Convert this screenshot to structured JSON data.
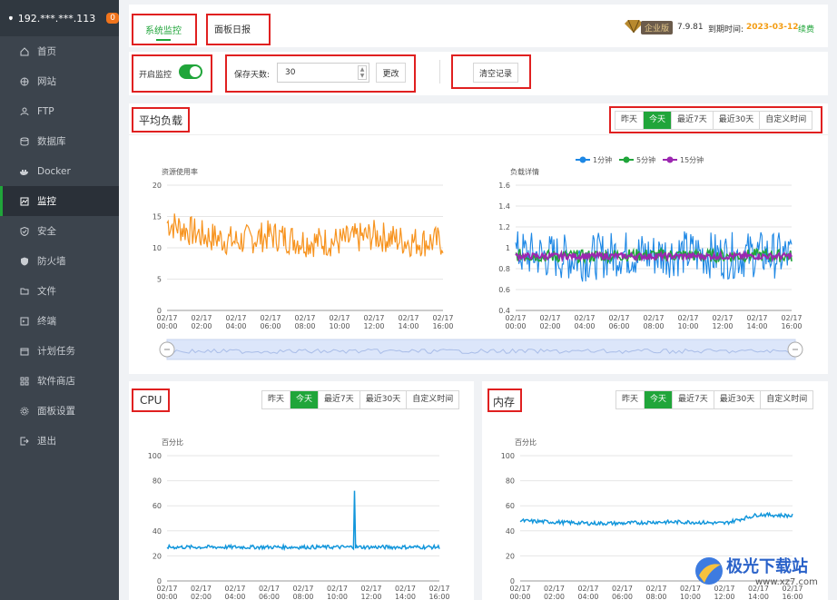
{
  "sidebar": {
    "ip": "192.***.***.113",
    "badge": "0",
    "items": [
      {
        "label": "首页",
        "icon": "home-icon"
      },
      {
        "label": "网站",
        "icon": "globe-icon"
      },
      {
        "label": "FTP",
        "icon": "ftp-icon"
      },
      {
        "label": "数据库",
        "icon": "database-icon"
      },
      {
        "label": "Docker",
        "icon": "docker-icon"
      },
      {
        "label": "监控",
        "icon": "monitor-icon",
        "active": true
      },
      {
        "label": "安全",
        "icon": "shield-check-icon"
      },
      {
        "label": "防火墙",
        "icon": "firewall-icon"
      },
      {
        "label": "文件",
        "icon": "folder-icon"
      },
      {
        "label": "终端",
        "icon": "terminal-icon"
      },
      {
        "label": "计划任务",
        "icon": "calendar-icon"
      },
      {
        "label": "软件商店",
        "icon": "apps-icon"
      },
      {
        "label": "面板设置",
        "icon": "gear-icon"
      },
      {
        "label": "退出",
        "icon": "logout-icon"
      }
    ]
  },
  "topbar": {
    "tab_monitor": "系统监控",
    "tab_daily": "面板日报",
    "edition": "企业版",
    "version": "7.9.81",
    "expire_label": "到期时间:",
    "expire_date": "2023-03-12",
    "renew": "续费"
  },
  "controls": {
    "monitor_label": "开启监控",
    "days_label": "保存天数:",
    "days_value": "30",
    "change_btn": "更改",
    "clear_btn": "清空记录"
  },
  "ranges": [
    "昨天",
    "今天",
    "最近7天",
    "最近30天",
    "自定义时间"
  ],
  "load": {
    "title": "平均负载",
    "left_label": "资源使用率",
    "right_label": "负载详情",
    "legend": [
      "1分钟",
      "5分钟",
      "15分钟"
    ],
    "legend_colors": [
      "#1e88e5",
      "#20a53a",
      "#9c27b0"
    ]
  },
  "cpu": {
    "title": "CPU",
    "ylabel": "百分比"
  },
  "mem": {
    "title": "内存",
    "ylabel": "百分比"
  },
  "watermark": {
    "text": "极光下载站",
    "url": "www.xz7.com"
  },
  "chart_data": [
    {
      "type": "line",
      "name": "资源使用率",
      "ylabel": "资源使用率",
      "ylim": [
        0,
        20
      ],
      "yticks": [
        0,
        5,
        10,
        15,
        20
      ],
      "x": [
        "02/17 00:00",
        "02/17 02:00",
        "02/17 04:00",
        "02/17 06:00",
        "02/17 08:00",
        "02/17 10:00",
        "02/17 12:00",
        "02/17 14:00",
        "02/17 16:00"
      ],
      "series": [
        {
          "values": [
            14,
            12,
            11,
            12,
            11,
            11,
            12,
            11,
            11
          ],
          "color": "#f7931e"
        }
      ]
    },
    {
      "type": "line",
      "name": "负载详情",
      "ylabel": "负载详情",
      "ylim": [
        0.4,
        1.6
      ],
      "yticks": [
        0.4,
        0.6,
        0.8,
        1,
        1.2,
        1.4,
        1.6
      ],
      "x": [
        "02/17 00:00",
        "02/17 02:00",
        "02/17 04:00",
        "02/17 06:00",
        "02/17 08:00",
        "02/17 10:00",
        "02/17 12:00",
        "02/17 14:00",
        "02/17 16:00"
      ],
      "series": [
        {
          "name": "1分钟",
          "values": [
            0.95,
            0.92,
            0.9,
            0.95,
            0.93,
            0.95,
            0.92,
            0.94,
            0.92
          ],
          "color": "#1e88e5"
        },
        {
          "name": "5分钟",
          "values": [
            0.93,
            0.92,
            0.92,
            0.93,
            0.93,
            0.93,
            0.92,
            0.93,
            0.92
          ],
          "color": "#20a53a"
        },
        {
          "name": "15分钟",
          "values": [
            0.92,
            0.92,
            0.92,
            0.92,
            0.92,
            0.92,
            0.92,
            0.92,
            0.92
          ],
          "color": "#9c27b0"
        }
      ]
    },
    {
      "type": "line",
      "name": "CPU",
      "ylabel": "百分比",
      "ylim": [
        0,
        100
      ],
      "yticks": [
        0,
        20,
        40,
        60,
        80,
        100
      ],
      "x": [
        "02/17 00:00",
        "02/17 02:00",
        "02/17 04:00",
        "02/17 06:00",
        "02/17 08:00",
        "02/17 10:00",
        "02/17 12:00",
        "02/17 14:00",
        "02/17 16:00"
      ],
      "series": [
        {
          "values": [
            27,
            27,
            27,
            27,
            27,
            27,
            27,
            27,
            27
          ],
          "peak": 72,
          "color": "#1296db"
        }
      ]
    },
    {
      "type": "line",
      "name": "内存",
      "ylabel": "百分比",
      "ylim": [
        0,
        100
      ],
      "yticks": [
        0,
        20,
        40,
        60,
        80,
        100
      ],
      "x": [
        "02/17 00:00",
        "02/17 02:00",
        "02/17 04:00",
        "02/17 06:00",
        "02/17 08:00",
        "02/17 10:00",
        "02/17 12:00",
        "02/17 14:00",
        "02/17 16:00"
      ],
      "series": [
        {
          "values": [
            48,
            47,
            46,
            46,
            47,
            47,
            46,
            53,
            52
          ],
          "color": "#1296db"
        }
      ]
    }
  ]
}
